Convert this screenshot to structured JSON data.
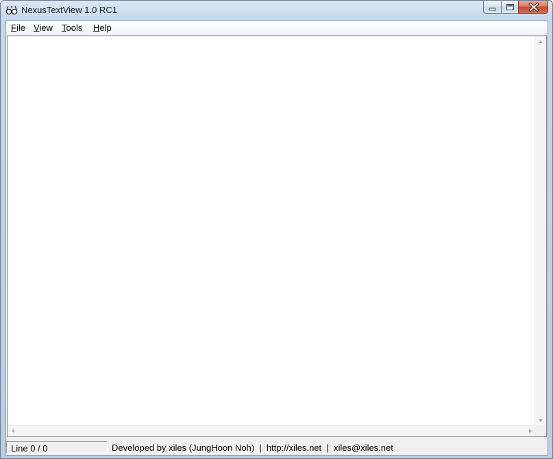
{
  "window": {
    "title": "NexusTextView 1.0 RC1",
    "icon": "glasses-app-icon",
    "buttons": [
      "minimize",
      "maximize",
      "close"
    ]
  },
  "menubar": {
    "items": [
      {
        "label": "File",
        "mnemonic": "F"
      },
      {
        "label": "View",
        "mnemonic": "V"
      },
      {
        "label": "Tools",
        "mnemonic": "T"
      },
      {
        "label": "Help",
        "mnemonic": "H"
      }
    ]
  },
  "editor": {
    "content": ""
  },
  "statusbar": {
    "line": "Line 0 / 0",
    "credits": "Developed by xiles (JungHoon Noh)  |  http://xiles.net  |  xiles@xiles.net"
  },
  "colors": {
    "frame": "#c6d8ec",
    "close_button": "#c24a33",
    "editor_background": "#ffffff"
  }
}
